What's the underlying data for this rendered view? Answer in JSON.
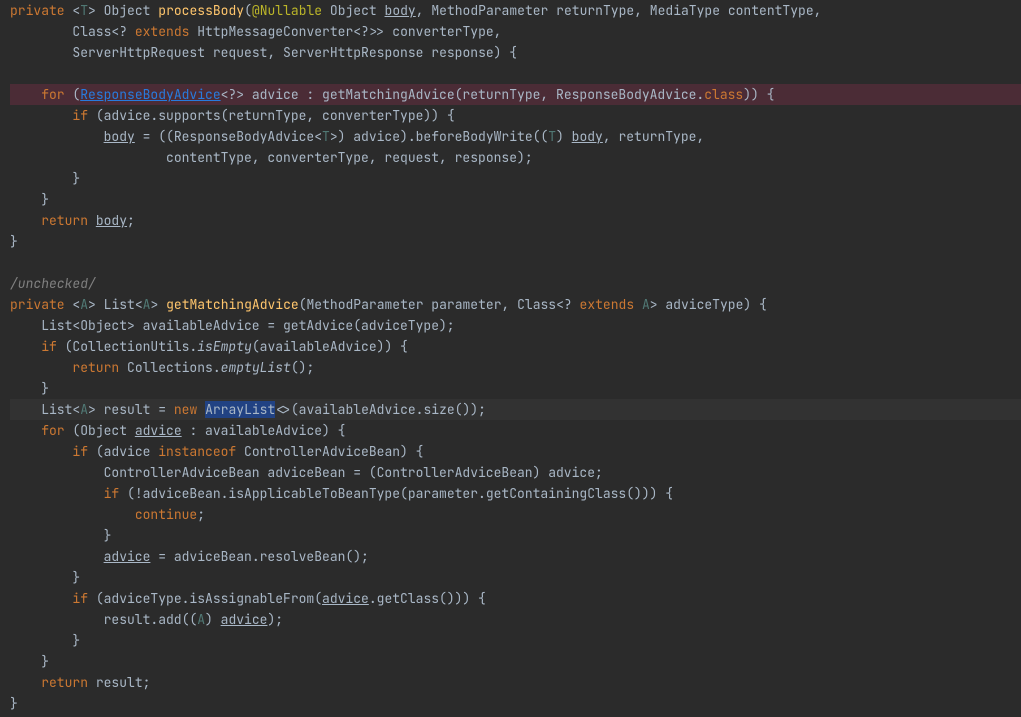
{
  "lines": {
    "l1_private": "private",
    "l1_t": "T",
    "l1_object": "Object",
    "l1_method": "processBody",
    "l1_annotation": "@Nullable",
    "l1_param1_type": "Object",
    "l1_param1_name": "body",
    "l1_param2_type": "MethodParameter",
    "l1_param2_name": "returnType",
    "l1_param3_type": "MediaType",
    "l1_param3_name": "contentType",
    "l2_param4_type_a": "Class<?",
    "l2_extends": "extends",
    "l2_param4_type_b": "HttpMessageConverter<?>>",
    "l2_param4_name": "converterType",
    "l3_param5_type": "ServerHttpRequest",
    "l3_param5_name": "request",
    "l3_param6_type": "ServerHttpResponse",
    "l3_param6_name": "response",
    "l5_for": "for",
    "l5_responsebodyadvice": "ResponseBodyAdvice",
    "l5_adv": "<?> advice : getMatchingAdvice(returnType, ResponseBodyAdvice.",
    "l5_class": "class",
    "l5_close": ")) {",
    "l6_if": "if",
    "l6_body": "(advice.supports(returnType, converterType)) {",
    "l7_body_a": "body",
    "l7_rest": " = ((ResponseBodyAdvice<",
    "l7_t": "T",
    "l7_rest2": ">) advice).beforeBodyWrite((",
    "l7_t2": "T",
    "l7_rest3": ") ",
    "l7_body_b": "body",
    "l7_rest4": ", returnType,",
    "l8_rest": "contentType, converterType, request, response);",
    "l11_return": "return",
    "l11_body": "body",
    "l14_unchecked": "/unchecked/",
    "l15_private": "private",
    "l15_a": "A",
    "l15_list": "List<",
    "l15_a2": "A",
    "l15_gt": ">",
    "l15_method": "getMatchingAdvice",
    "l15_p1": "(MethodParameter parameter, Class<?",
    "l15_extends": "extends",
    "l15_a3": "A",
    "l15_rest": "> adviceType) {",
    "l16_body": "List<Object> availableAdvice = getAdvice(adviceType);",
    "l17_if": "if",
    "l17_a": "(CollectionUtils.",
    "l17_isEmpty": "isEmpty",
    "l17_b": "(availableAdvice)) {",
    "l18_return": "return",
    "l18_a": "Collections.",
    "l18_empty": "emptyList",
    "l18_b": "();",
    "l20_a": "List<",
    "l20_aa": "A",
    "l20_b": "> result = ",
    "l20_new": "new",
    "l20_arraylist": "ArrayList",
    "l20_c": "<>(availableAdvice.size());",
    "l21_for": "for",
    "l21_a": "(Object ",
    "l21_advice": "advice",
    "l21_b": " : availableAdvice) {",
    "l22_if": "if",
    "l22_a": "(advice ",
    "l22_instanceof": "instanceof",
    "l22_b": " ControllerAdviceBean) {",
    "l23_a": "ControllerAdviceBean adviceBean = (ControllerAdviceBean) advice;",
    "l24_if": "if",
    "l24_a": "(!adviceBean.isApplicableToBeanType(parameter.getContainingClass())) {",
    "l25_continue": "continue",
    "l27_advice": "advice",
    "l27_a": " = adviceBean.resolveBean();",
    "l29_if": "if",
    "l29_a": "(adviceType.isAssignableFrom(",
    "l29_advice": "advice",
    "l29_b": ".getClass())) {",
    "l30_a": "result.add((",
    "l30_aa": "A",
    "l30_b": ") ",
    "l30_advice": "advice",
    "l30_c": ");",
    "l33_return": "return",
    "l33_a": "result;"
  }
}
